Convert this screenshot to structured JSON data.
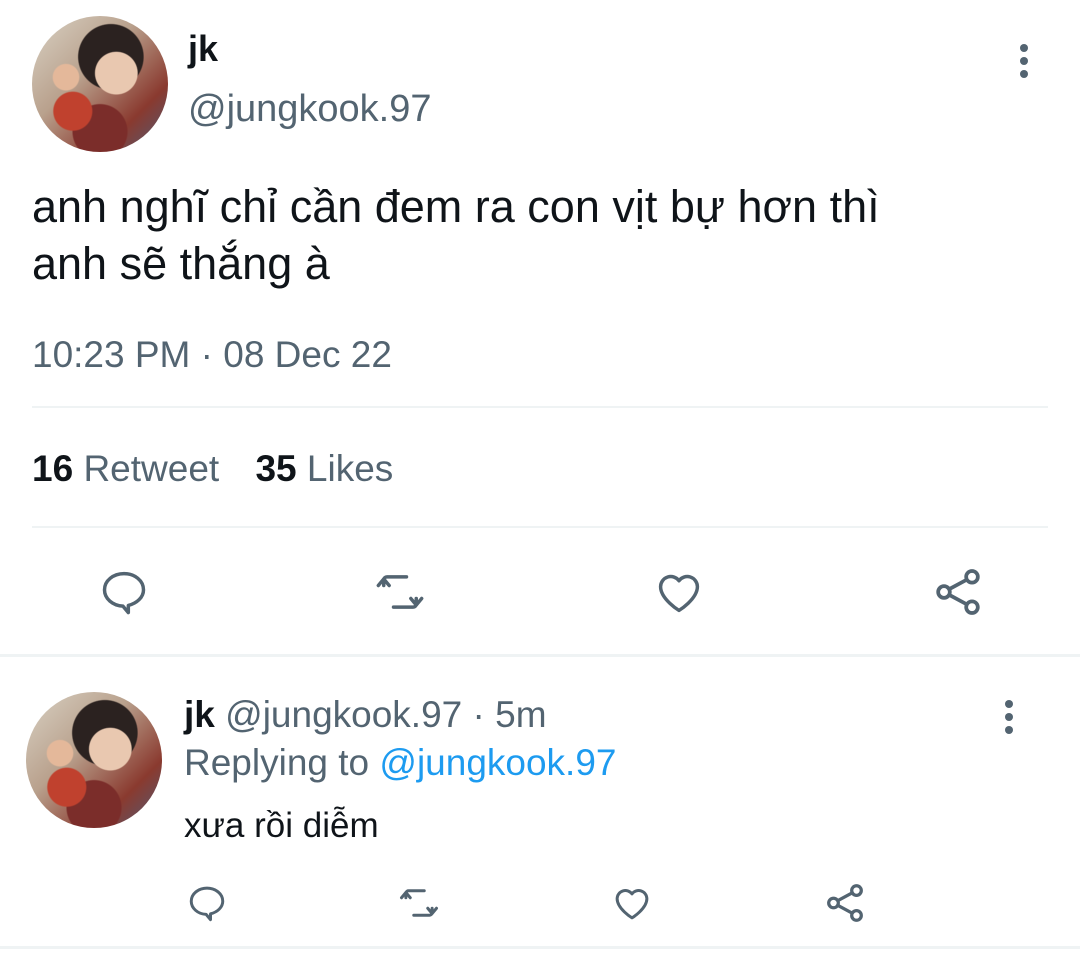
{
  "tweet": {
    "display_name": "jk",
    "handle": "@jungkook.97",
    "text_line1": "anh nghĩ chỉ cần đem ra con vịt bự hơn thì",
    "text_line2": "anh sẽ thắng à",
    "timestamp": "10:23 PM · 08 Dec 22",
    "retweet_count": "16",
    "retweet_label": "Retweet",
    "like_count": "35",
    "like_label": "Likes",
    "icons": [
      "reply-icon",
      "retweet-icon",
      "like-icon",
      "share-icon",
      "more-icon"
    ]
  },
  "reply": {
    "display_name": "jk",
    "handle": "@jungkook.97",
    "separator": "·",
    "time_ago": "5m",
    "replying_prefix": "Replying to",
    "replying_handle": "@jungkook.97",
    "text": "xưa rồi diễm",
    "icons": [
      "reply-icon",
      "retweet-icon",
      "like-icon",
      "share-icon",
      "more-icon"
    ]
  },
  "colors": {
    "muted": "#536471",
    "link": "#1d9bf0",
    "divider": "#eff3f4",
    "text": "#0f1419"
  }
}
